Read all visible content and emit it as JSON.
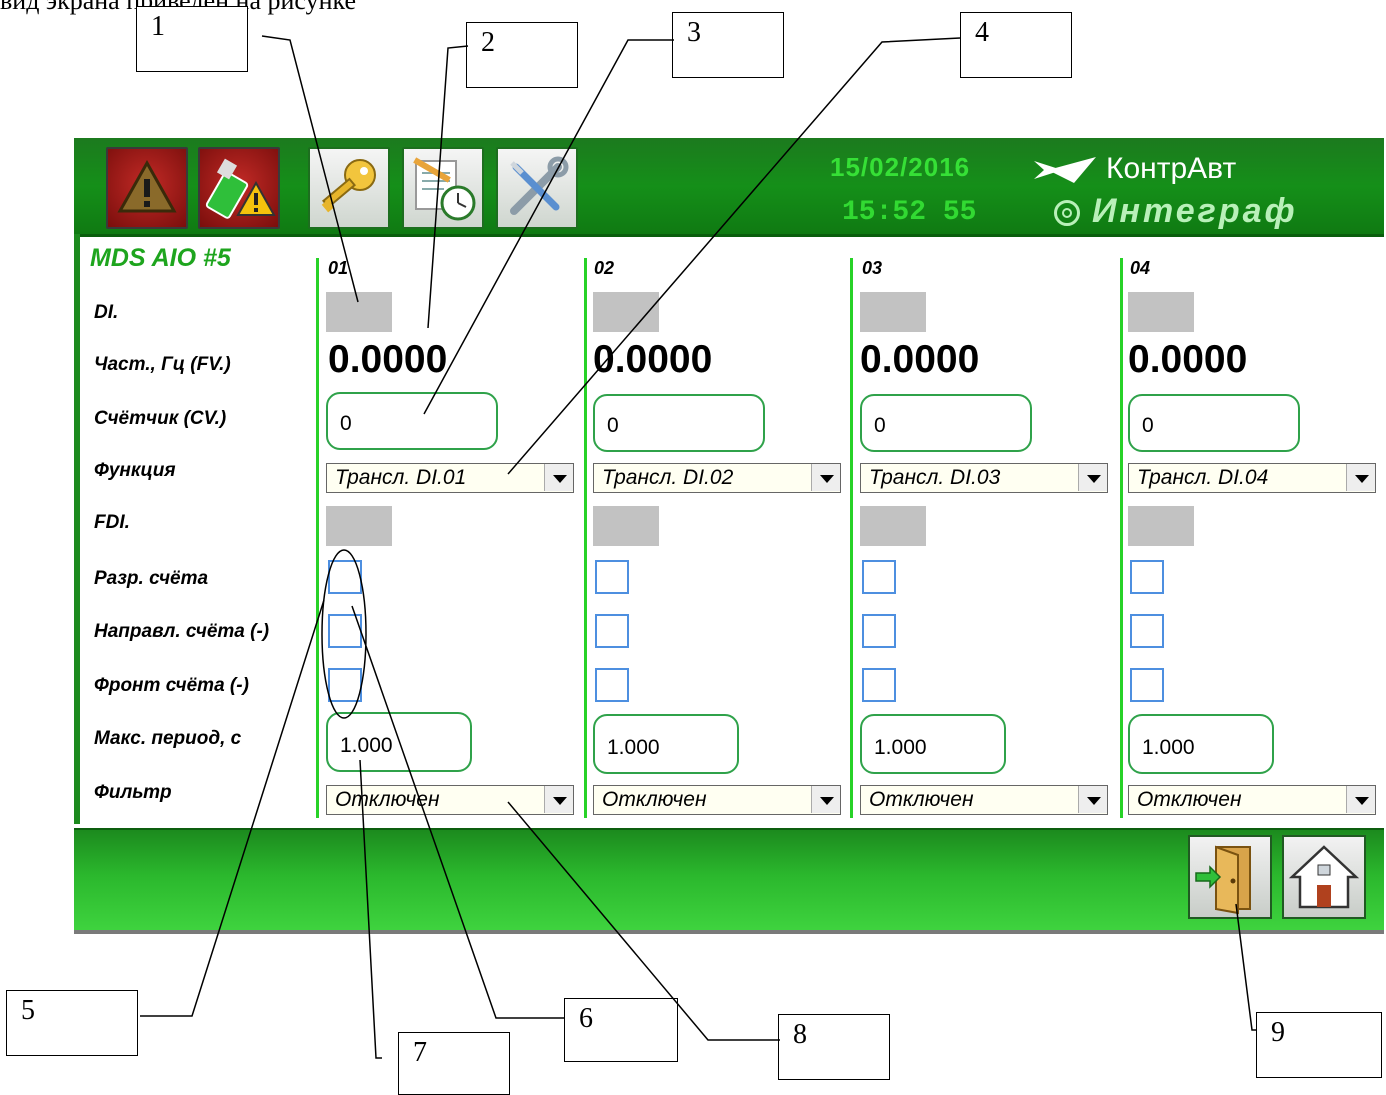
{
  "intro_text": "вид экрана приведен на рисунке",
  "callouts": [
    "1",
    "2",
    "3",
    "4",
    "5",
    "6",
    "7",
    "8",
    "9"
  ],
  "header": {
    "date": "15/02/2016",
    "time": "15:52  55",
    "brand_name": "КонтрАвт",
    "brand_product": "Интеграф",
    "buttons": [
      "alarm-icon",
      "usb-alarm-icon",
      "key-icon",
      "calendar-clock-icon",
      "tools-icon"
    ]
  },
  "device_title": "MDS AIO #5",
  "row_labels": {
    "di": "DI.",
    "freq": "Част., Гц (FV.)",
    "counter": "Счётчик (CV.)",
    "function": "Функция",
    "fdi": "FDI.",
    "count_enable": "Разр. счёта",
    "count_direction": "Направл. счёта (-)",
    "count_front": "Фронт  счёта (-)",
    "max_period": "Макс. период, с",
    "filter": "Фильтр"
  },
  "channels": [
    {
      "num": "01",
      "freq": "0.0000",
      "counter": "0",
      "function": "Трансл. DI.01",
      "max_period": "1.000",
      "filter": "Отключен",
      "count_enable": false,
      "count_direction": false,
      "count_front": false
    },
    {
      "num": "02",
      "freq": "0.0000",
      "counter": "0",
      "function": "Трансл. DI.02",
      "max_period": "1.000",
      "filter": "Отключен",
      "count_enable": false,
      "count_direction": false,
      "count_front": false
    },
    {
      "num": "03",
      "freq": "0.0000",
      "counter": "0",
      "function": "Трансл. DI.03",
      "max_period": "1.000",
      "filter": "Отключен",
      "count_enable": false,
      "count_direction": false,
      "count_front": false
    },
    {
      "num": "04",
      "freq": "0.0000",
      "counter": "0",
      "function": "Трансл. DI.04",
      "max_period": "1.000",
      "filter": "Отключен",
      "count_enable": false,
      "count_direction": false,
      "count_front": false
    }
  ],
  "footer": {
    "buttons": [
      "exit-door-icon",
      "home-icon"
    ]
  },
  "colors": {
    "header_green": "#158f19",
    "accent_green": "#27d227",
    "input_border": "#2fa24a",
    "checkbox_border": "#4d8fe0",
    "led_off": "#c2c2c2"
  }
}
